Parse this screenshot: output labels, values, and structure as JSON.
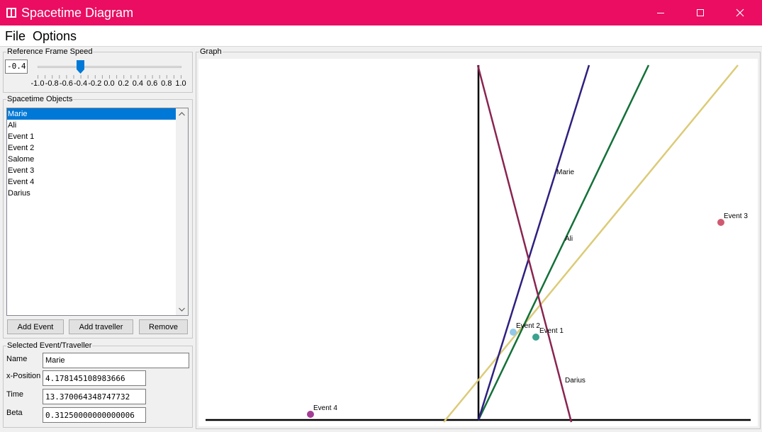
{
  "window": {
    "title": "Spacetime Diagram"
  },
  "menu": {
    "items": [
      "File",
      "Options"
    ]
  },
  "speed": {
    "legend": "Reference Frame Speed",
    "input_value": "-0.4",
    "value": -0.4,
    "min": -1.0,
    "max": 1.0,
    "tick_labels": [
      "-1.0",
      "-0.8",
      "-0.6",
      "-0.4",
      "-0.2",
      "0.0",
      "0.2",
      "0.4",
      "0.6",
      "0.8",
      "1.0"
    ]
  },
  "objects": {
    "legend": "Spacetime Objects",
    "items": [
      "Marie",
      "Ali",
      "Event 1",
      "Event 2",
      "Salome",
      "Event 3",
      "Event 4",
      "Darius"
    ],
    "selected": "Marie"
  },
  "buttons": {
    "add_event": "Add Event",
    "add_traveller": "Add traveller",
    "remove": "Remove"
  },
  "selected": {
    "legend": "Selected Event/Traveller",
    "name_label": "Name",
    "name_value": "Marie",
    "x_label": "x-Position",
    "x_value": "4.178145108983666",
    "time_label": "Time",
    "time_value": "13.370064348747732",
    "beta_label": "Beta",
    "beta_value": "0.31250000000000006"
  },
  "graph": {
    "legend": "Graph",
    "labels": {
      "marie": "Marie",
      "ali": "Ali",
      "darius": "Darius",
      "event1": "Event 1",
      "event2": "Event 2",
      "event3": "Event 3",
      "event4": "Event 4"
    },
    "colors": {
      "axis": "#000000",
      "marie": "#2e2080",
      "ali": "#137039",
      "salome": "#dccb78",
      "darius": "#8a2450",
      "event1": "#3aa290",
      "event2": "#92c8e8",
      "event3": "#cf5a70",
      "event4": "#a43e94"
    }
  }
}
